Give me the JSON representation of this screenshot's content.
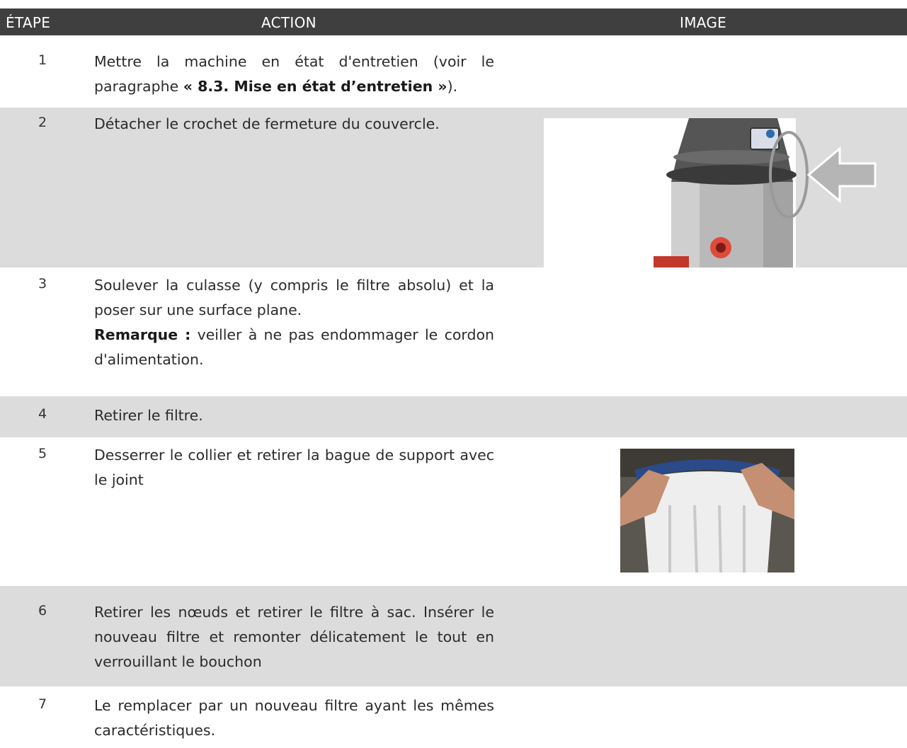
{
  "header": {
    "step": "ÉTAPE",
    "action": "ACTION",
    "image": "IMAGE"
  },
  "steps": [
    {
      "num": "1",
      "text_a": "Mettre la machine en état d'entretien (voir le paragraphe ",
      "text_bold": "« 8.3. Mise en état d’entretien »",
      "text_b": ")."
    },
    {
      "num": "2",
      "text": "Détacher le crochet de fermeture du couvercle."
    },
    {
      "num": "3",
      "text": "Soulever la culasse (y compris le filtre absolu) et la poser sur une surface plane.",
      "note_label": "Remarque :",
      "note_text": " veiller à ne pas endommager le cordon d'alimentation."
    },
    {
      "num": "4",
      "text": "Retirer le filtre."
    },
    {
      "num": "5",
      "text": "Desserrer le collier et retirer la bague de support avec le joint"
    },
    {
      "num": "6",
      "text": "Retirer les nœuds et retirer le filtre à sac. Insérer le nouveau filtre et remonter délicatement le tout en verrouillant le bouchon"
    },
    {
      "num": "7",
      "text": "Le remplacer par un nouveau filtre ayant les mêmes caractéristiques."
    }
  ],
  "colors": {
    "header_bg": "#3f3f3f",
    "row_shade": "#dcdcdc"
  }
}
